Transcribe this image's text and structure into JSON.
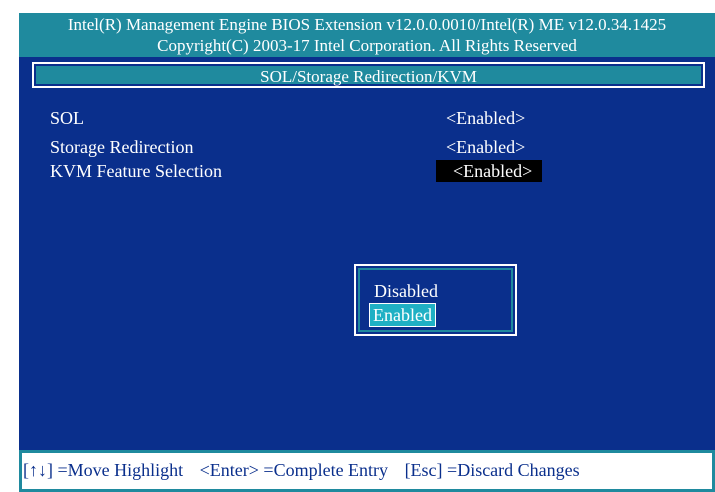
{
  "header": {
    "line1": "Intel(R) Management Engine BIOS Extension v12.0.0.0010/Intel(R) ME v12.0.34.1425",
    "line2": "Copyright(C) 2003-17 Intel Corporation. All Rights Reserved"
  },
  "page": {
    "title": "SOL/Storage Redirection/KVM"
  },
  "settings": [
    {
      "label": "SOL",
      "value": "<Enabled>"
    },
    {
      "label": "Storage Redirection",
      "value": "<Enabled>"
    },
    {
      "label": "KVM Feature Selection",
      "value": "<Enabled>",
      "selected": true
    }
  ],
  "popup": {
    "options": [
      "Disabled",
      "Enabled"
    ],
    "highlighted": "Enabled"
  },
  "footer": {
    "move": "[↑↓] =Move Highlight",
    "enter": "<Enter> =Complete Entry",
    "esc": "[Esc] =Discard Changes"
  },
  "colors": {
    "background": "#0a2f8c",
    "accent": "#1f8a9e",
    "highlight": "#1fb0c4",
    "selected_bg": "#000000"
  }
}
